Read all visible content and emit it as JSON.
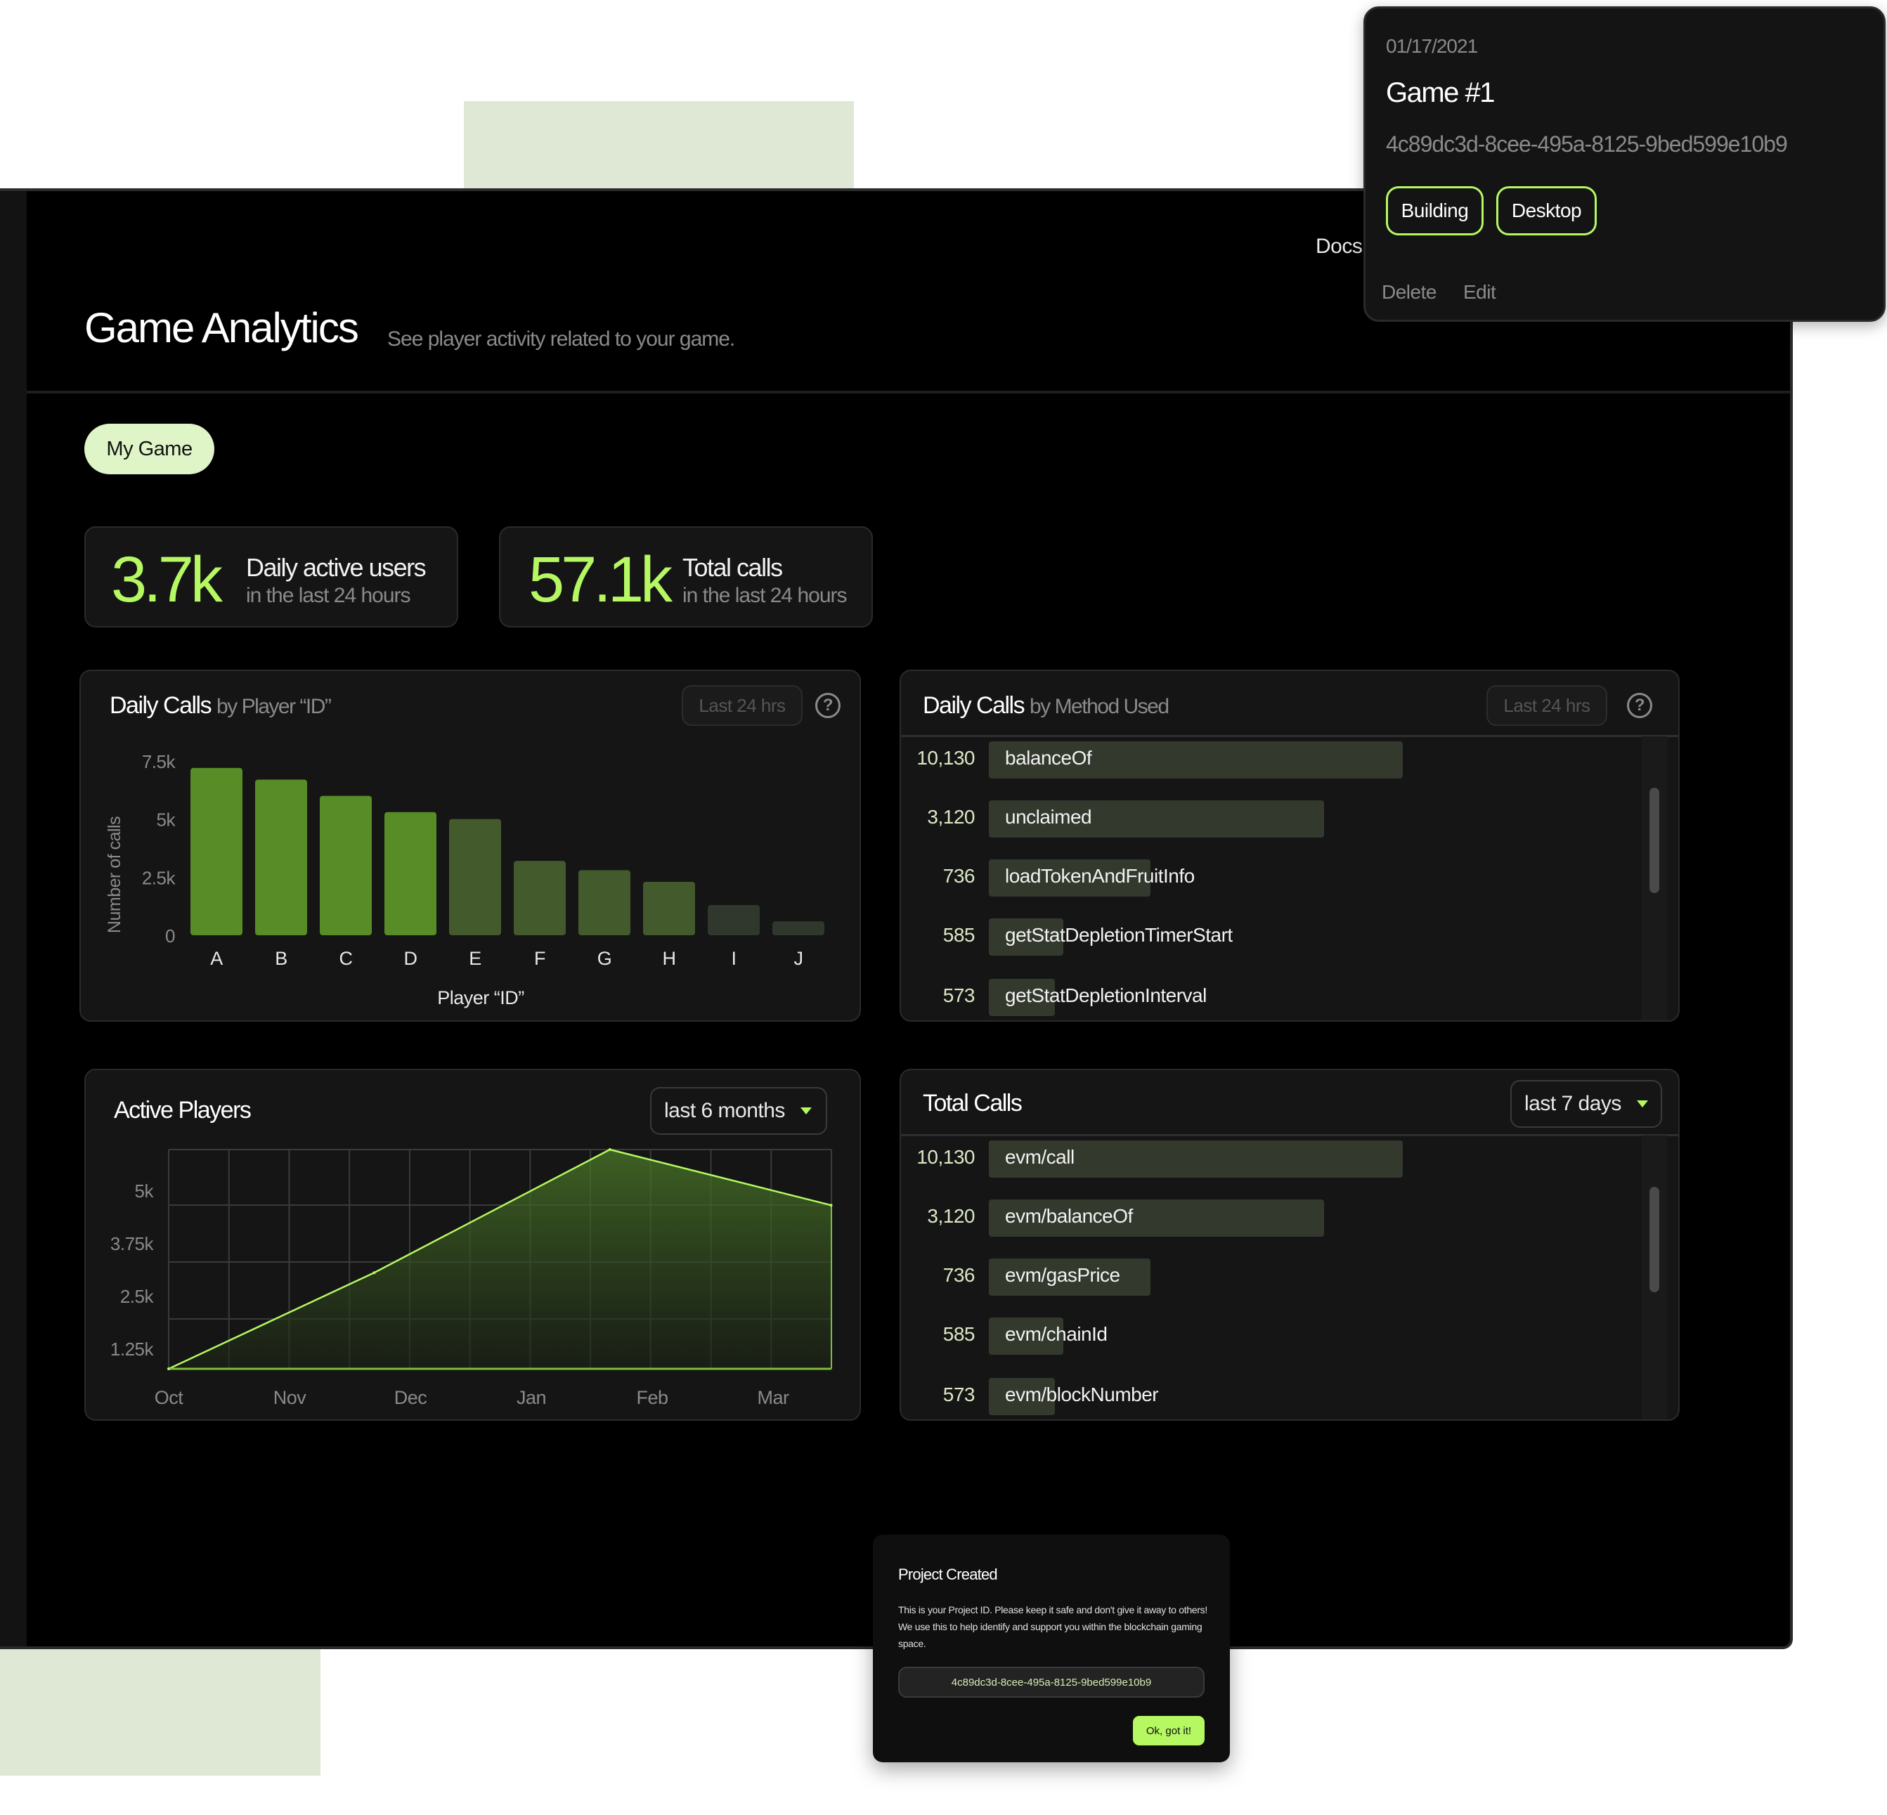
{
  "header": {
    "title": "Game Analytics",
    "subtitle": "See player activity related to your game.",
    "docs_link": "Docs"
  },
  "game_tab": "My Game",
  "stats": [
    {
      "value": "3.7k",
      "label": "Daily active users",
      "sublabel": "in the last 24 hours"
    },
    {
      "value": "57.1k",
      "label": "Total calls",
      "sublabel": "in the last 24 hours"
    }
  ],
  "colors": {
    "accent": "#b5f862",
    "bar_bright": "#588c26",
    "bar_mid": "#425a2c",
    "bar_dim": "#30372c",
    "method_bar": "#33392d",
    "panel": "#151515"
  },
  "daily_calls_player": {
    "title": "Daily Calls",
    "title_suffix": "by Player “ID”",
    "range_button": "Last 24 hrs",
    "help_icon": "question-circle-icon"
  },
  "daily_calls_method": {
    "title": "Daily Calls",
    "title_suffix": "by Method Used",
    "range_button": "Last 24 hrs",
    "help_icon": "question-circle-icon",
    "rows": [
      {
        "value": "10,130",
        "label": "balanceOf",
        "fill": 1.0
      },
      {
        "value": "3,120",
        "label": "unclaimed",
        "fill": 0.81
      },
      {
        "value": "736",
        "label": "loadTokenAndFruitInfo",
        "fill": 0.39
      },
      {
        "value": "585",
        "label": "getStatDepletionTimerStart",
        "fill": 0.18
      },
      {
        "value": "573",
        "label": "getStatDepletionInterval",
        "fill": 0.16
      }
    ]
  },
  "active_players": {
    "title": "Active Players",
    "dropdown": "last 6 months"
  },
  "total_calls": {
    "title": "Total Calls",
    "dropdown": "last 7 days",
    "rows": [
      {
        "value": "10,130",
        "label": "evm/call",
        "fill": 1.0
      },
      {
        "value": "3,120",
        "label": "evm/balanceOf",
        "fill": 0.81
      },
      {
        "value": "736",
        "label": "evm/gasPrice",
        "fill": 0.39
      },
      {
        "value": "585",
        "label": "evm/chainId",
        "fill": 0.18
      },
      {
        "value": "573",
        "label": "evm/blockNumber",
        "fill": 0.16
      }
    ]
  },
  "game_card": {
    "date": "01/17/2021",
    "name": "Game #1",
    "id": "4c89dc3d-8cee-495a-8125-9bed599e10b9",
    "tags": [
      "Building",
      "Desktop"
    ],
    "delete": "Delete",
    "edit": "Edit"
  },
  "modal": {
    "title": "Project Created",
    "body": "This is your Project ID. Please keep it safe and don't give it away to others! We use this to help identify and support you within the blockchain gaming space.",
    "project_id": "4c89dc3d-8cee-495a-8125-9bed599e10b9",
    "ok_button": "Ok, got it!"
  },
  "chart_data": [
    {
      "type": "bar",
      "title": "Daily Calls by Player “ID”",
      "xlabel": "Player “ID”",
      "ylabel": "Number of calls",
      "categories": [
        "A",
        "B",
        "C",
        "D",
        "E",
        "F",
        "G",
        "H",
        "I",
        "J"
      ],
      "values": [
        7200,
        6700,
        6000,
        5300,
        5000,
        3200,
        2800,
        2300,
        1300,
        600
      ],
      "emphasis": [
        "bright",
        "bright",
        "bright",
        "bright",
        "mid",
        "mid",
        "mid",
        "mid",
        "dim",
        "dim"
      ],
      "yticks": [
        "0",
        "2.5k",
        "5k",
        "7.5k"
      ],
      "ytick_values": [
        0,
        2500,
        5000,
        7500
      ],
      "ylim": [
        0,
        7500
      ],
      "grid": false,
      "legend": "none"
    },
    {
      "type": "area",
      "title": "Active Players",
      "categories": [
        "Oct",
        "Nov",
        "Dec",
        "Jan",
        "Feb",
        "Mar"
      ],
      "points": [
        {
          "month_index": 0,
          "value": 770
        },
        {
          "month_index": 1.7,
          "value": 3050
        },
        {
          "month_index": 3.65,
          "value": 5970
        },
        {
          "month_index": 5.48,
          "value": 4650
        }
      ],
      "yticks": [
        "1.25k",
        "2.5k",
        "3.75k",
        "5k"
      ],
      "ytick_values": [
        1250,
        2500,
        3750,
        5000
      ],
      "ylim": [
        770,
        5970
      ],
      "grid": true,
      "legend": "none"
    }
  ]
}
